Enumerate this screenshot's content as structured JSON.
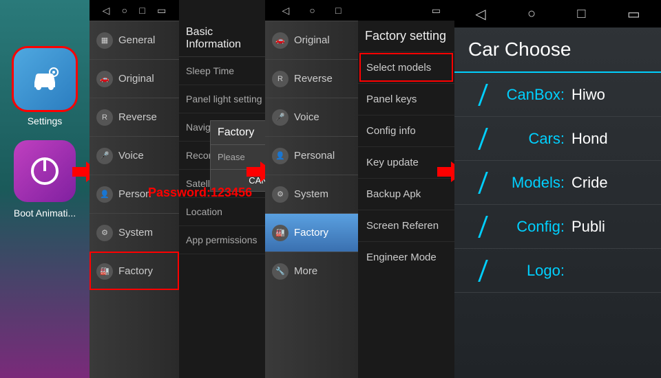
{
  "home": {
    "settings_label": "Settings",
    "boot_label": "Boot Animati..."
  },
  "settings_panel2": {
    "items": [
      "General",
      "Original",
      "Reverse",
      "Voice",
      "Person",
      "System",
      "Factory"
    ]
  },
  "basic_info": {
    "title": "Basic Information",
    "rows": [
      "Sleep Time",
      "Panel light setting",
      "Navigation",
      "Record",
      "Satellite info",
      "Location",
      "App permissions"
    ]
  },
  "factory_dialog": {
    "title": "Factory",
    "subtitle": "Please",
    "cancel": "CAN"
  },
  "password_overlay": "Password:123456",
  "settings_panel3": {
    "items": [
      "Original",
      "Reverse",
      "Voice",
      "Personal",
      "System",
      "Factory",
      "More"
    ]
  },
  "factory_settings": {
    "title": "Factory setting",
    "rows": [
      "Select models",
      "Panel keys",
      "Config info",
      "Key update",
      "Backup Apk",
      "Screen Referen",
      "Engineer Mode"
    ]
  },
  "car_choose": {
    "title": "Car Choose",
    "rows": [
      {
        "label": "CanBox:",
        "value": "Hiwo"
      },
      {
        "label": "Cars:",
        "value": "Hond"
      },
      {
        "label": "Models:",
        "value": "Cride"
      },
      {
        "label": "Config:",
        "value": "Publi"
      },
      {
        "label": "Logo:",
        "value": ""
      }
    ]
  }
}
